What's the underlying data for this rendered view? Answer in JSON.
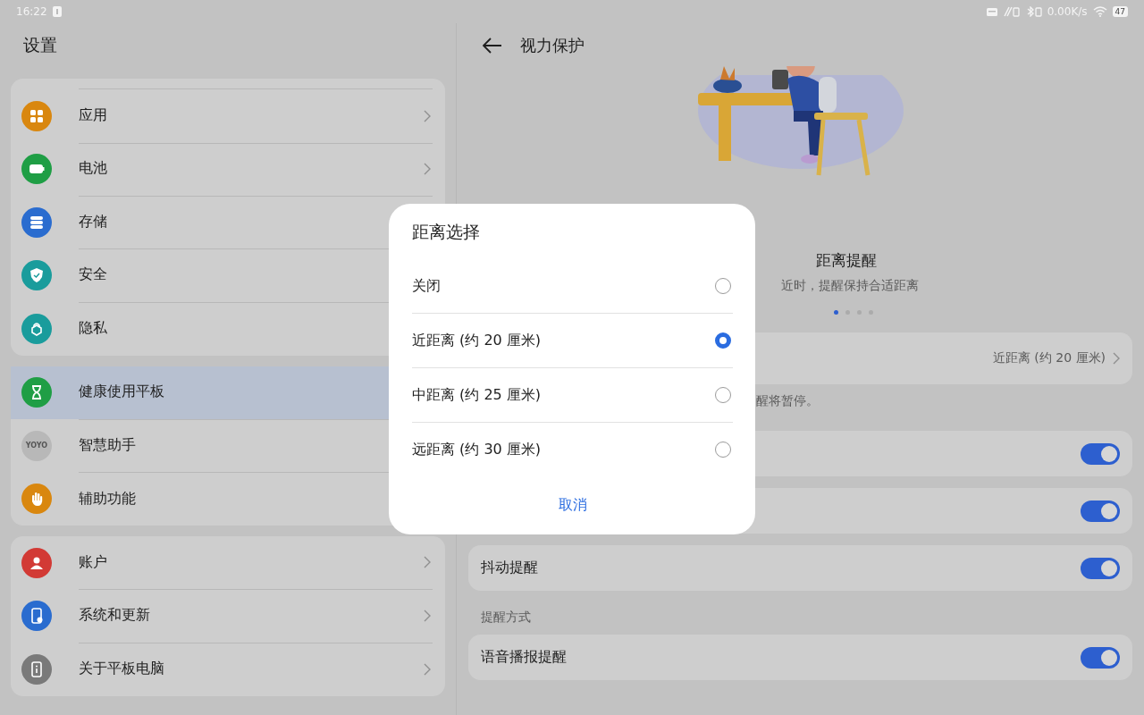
{
  "status_bar": {
    "time": "16:22",
    "network_speed": "0.00K/s",
    "battery": "47"
  },
  "sidebar": {
    "title": "设置",
    "groups": [
      {
        "items": [
          {
            "label": "应用",
            "color": "#d9870f",
            "chevron": true,
            "selected": false
          },
          {
            "label": "电池",
            "color": "#1f9e45",
            "chevron": true,
            "selected": false
          },
          {
            "label": "存储",
            "color": "#2a6ccf",
            "selected": false
          },
          {
            "label": "安全",
            "color": "#1a9c9c",
            "selected": false
          },
          {
            "label": "隐私",
            "color": "#1a9c9c",
            "selected": false
          }
        ]
      },
      {
        "items": [
          {
            "label": "健康使用平板",
            "color": "#1f9e45",
            "selected": true
          },
          {
            "label": "智慧助手",
            "color": "#b8b8b8",
            "icon_text": "YOYO",
            "selected": false
          },
          {
            "label": "辅助功能",
            "color": "#d9870f",
            "selected": false
          }
        ]
      },
      {
        "items": [
          {
            "label": "账户",
            "color": "#d23a35",
            "chevron": true,
            "selected": false
          },
          {
            "label": "系统和更新",
            "color": "#2a6ccf",
            "chevron": true,
            "selected": false
          },
          {
            "label": "关于平板电脑",
            "color": "#7a7a7a",
            "chevron": true,
            "selected": false
          }
        ]
      }
    ]
  },
  "detail": {
    "title": "视力保护",
    "feature_title": "距离提醒",
    "feature_subtitle": "近时，提醒保持合适距离",
    "pages": [
      {
        "selected": true
      },
      {
        "selected": false
      },
      {
        "selected": false
      },
      {
        "selected": false
      }
    ],
    "rows": [
      {
        "kind": "value",
        "value": "近距离 (约 20 厘米)"
      },
      {
        "kind": "note",
        "text": "醒将暂停。"
      },
      {
        "kind": "toggle",
        "on": true
      },
      {
        "kind": "toggle",
        "on": true
      },
      {
        "kind": "toggle",
        "label": "抖动提醒",
        "on": true
      },
      {
        "kind": "section",
        "text": "提醒方式"
      },
      {
        "kind": "toggle",
        "label": "语音播报提醒",
        "on": true
      }
    ]
  },
  "dialog": {
    "title": "距离选择",
    "options": [
      {
        "label": "关闭",
        "selected": false
      },
      {
        "label": "近距离 (约 20 厘米)",
        "selected": true
      },
      {
        "label": "中距离 (约 25 厘米)",
        "selected": false
      },
      {
        "label": "远距离 (约 30 厘米)",
        "selected": false
      }
    ],
    "cancel": "取消"
  }
}
